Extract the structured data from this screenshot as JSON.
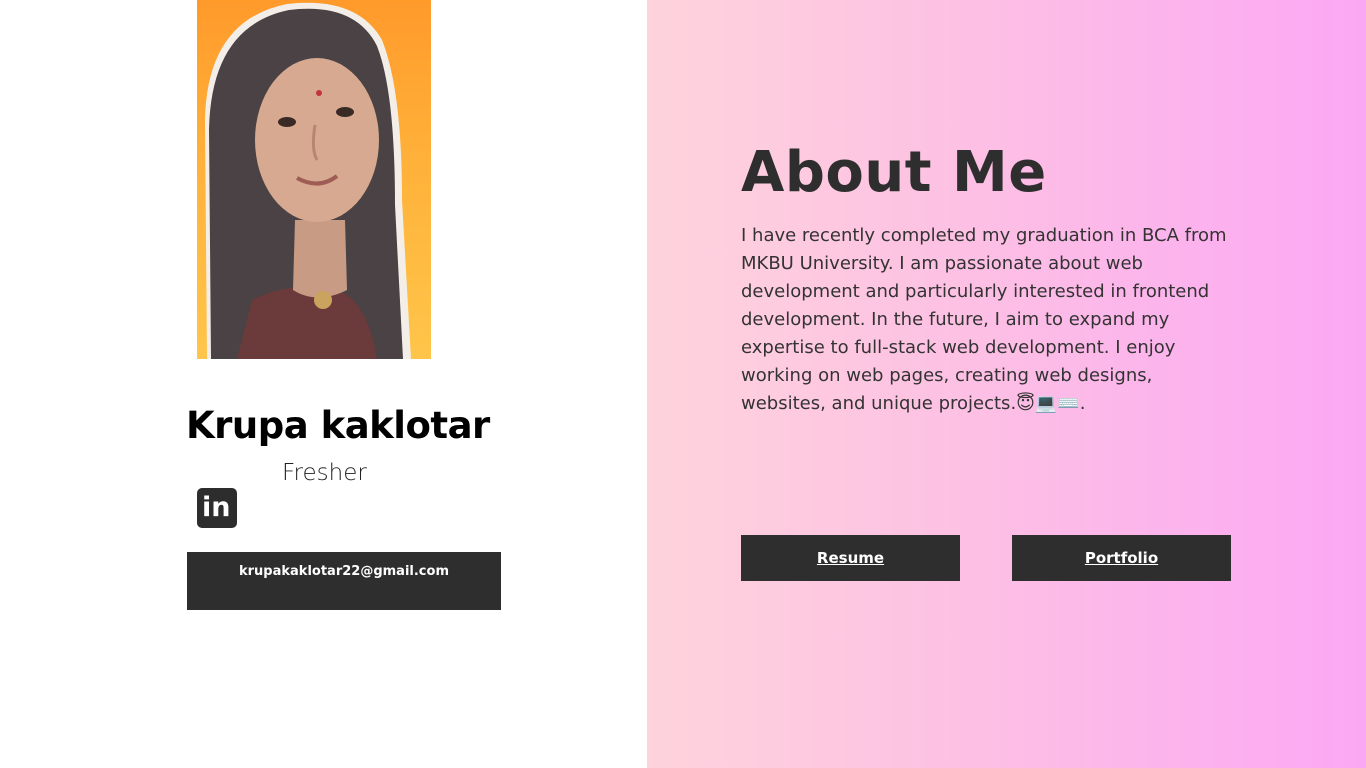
{
  "profile": {
    "name": "Krupa kaklotar",
    "role": "Fresher",
    "email": "krupakaklotar22@gmail.com",
    "linkedin_label": "in",
    "photo_alt": "profile-photo"
  },
  "about": {
    "title": "About Me",
    "text": "I have recently completed my graduation in BCA from MKBU University. I am passionate about web development and particularly interested in frontend development. In the future, I aim to expand my expertise to full-stack web development. I enjoy working on web pages, creating web designs, websites, and unique projects.😇💻⌨️."
  },
  "buttons": {
    "resume": "Resume",
    "portfolio": "Portfolio"
  },
  "colors": {
    "dark": "#2e2e2e",
    "gradient_start": "#fed3dc",
    "gradient_end": "#fba8f4"
  },
  "icons": {
    "linkedin": "linkedin-icon"
  }
}
